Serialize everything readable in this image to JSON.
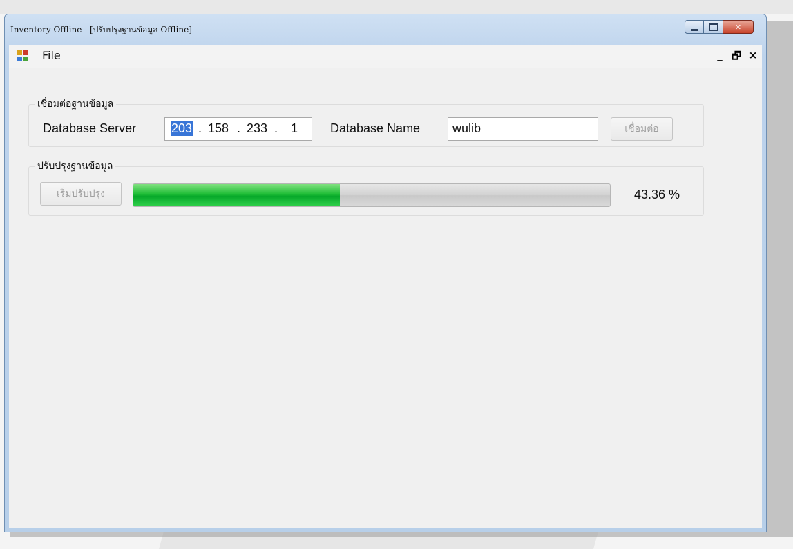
{
  "window": {
    "title": "Inventory Offline - [ปรับปรุงฐานข้อมูล Offline]"
  },
  "menubar": {
    "items": [
      {
        "label": "File"
      }
    ],
    "mdi_minimize": "_",
    "mdi_restore": "🗗",
    "mdi_close": "×"
  },
  "connection_group": {
    "legend": "เชื่อมต่อฐานข้อมูล",
    "server_label": "Database Server",
    "ip": [
      "203",
      "158",
      "233",
      "1"
    ],
    "ip_separator": ".",
    "dbname_label": "Database Name",
    "dbname_value": "wulib",
    "connect_button": "เชื่อมต่อ"
  },
  "update_group": {
    "legend": "ปรับปรุงฐานข้อมูล",
    "start_button": "เริ่มปรับปรุง",
    "progress_percent": 43.36,
    "progress_text": "43.36 %"
  },
  "colors": {
    "progress_fill": "#07a82a",
    "selection": "#3875d7",
    "close_button": "#c8432b"
  }
}
